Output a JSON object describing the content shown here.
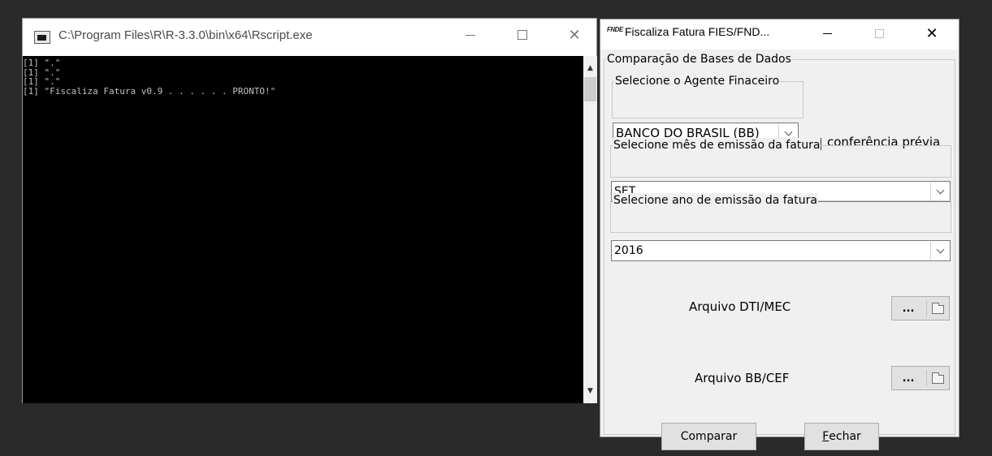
{
  "console": {
    "title": "C:\\Program Files\\R\\R-3.3.0\\bin\\x64\\Rscript.exe",
    "output": "[1] \".\"\n[1] \".\"\n[1] \".\"\n[1] \"Fiscaliza Fatura v0.9 . . . . . . PRONTO!\"",
    "background": "#000000",
    "text_color": "#c0c0c0"
  },
  "dialog": {
    "app_icon_text": "FNDE",
    "title": "Fiscaliza Fatura FIES/FND...",
    "group_label": "Comparação de Bases de Dados",
    "agent_group_label": "Selecione o Agente Finaceiro",
    "agent_value": "BANCO DO BRASIL (BB)",
    "prior_check_label": "conferência prévia",
    "prior_check_checked": false,
    "month_group_label": "Selecione mês de emissão da fatura",
    "month_value": "SET",
    "year_group_label": "Selecione ano de emissão da fatura",
    "year_value": "2016",
    "dti_label": "Arquivo DTI/MEC",
    "bb_label": "Arquivo BB/CEF",
    "browse_label": "...",
    "compare_label": "Comparar",
    "close_label_mnemonic": "F",
    "close_label_rest": "echar"
  },
  "icons": [
    "console-app-icon",
    "fnde-logo-icon",
    "minimize-icon",
    "maximize-icon",
    "close-icon",
    "chevron-down-icon",
    "folder-icon",
    "scroll-up-icon",
    "scroll-down-icon"
  ]
}
